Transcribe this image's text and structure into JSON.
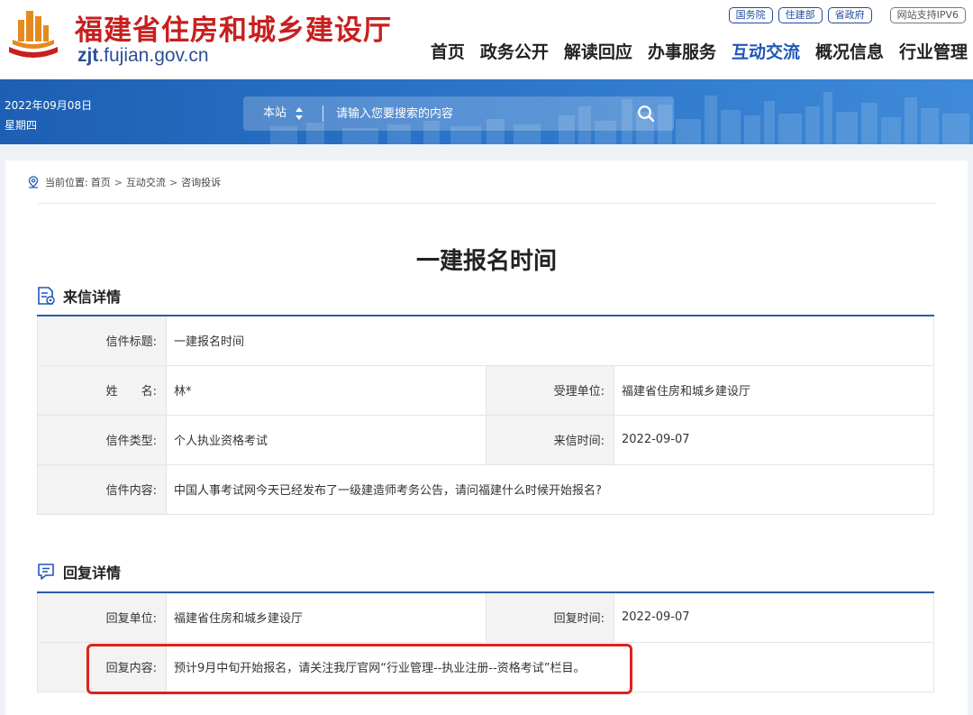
{
  "header": {
    "site_name": "福建省住房和城乡建设厅",
    "domain_bold": "zjt",
    "domain_rest": ".fujian.gov.cn",
    "top_links": [
      "国务院",
      "住建部",
      "省政府"
    ],
    "ipv6": "网站支持IPV6",
    "nav": [
      "首页",
      "政务公开",
      "解读回应",
      "办事服务",
      "互动交流",
      "概况信息",
      "行业管理"
    ],
    "active_nav": "互动交流",
    "colors": {
      "site_name": "#c81f1f",
      "active": "#1f56b8",
      "banner": "#2a73c8"
    }
  },
  "banner": {
    "date": "2022年09月08日",
    "weekday": "星期四",
    "search": {
      "scope": "本站",
      "placeholder": "请输入您要搜索的内容",
      "button_icon": "search-icon"
    }
  },
  "breadcrumb": {
    "prefix": "当前位置:",
    "items": [
      "首页",
      "互动交流",
      "咨询投诉"
    ],
    "separator": ">"
  },
  "page_title": "一建报名时间",
  "letter_section": {
    "title": "来信详情",
    "icon": "document-icon",
    "rows": {
      "title_label": "信件标题:",
      "title_value": "一建报名时间",
      "name_label": "姓　　名:",
      "name_value": "林*",
      "dept_label": "受理单位:",
      "dept_value": "福建省住房和城乡建设厅",
      "type_label": "信件类型:",
      "type_value": "个人执业资格考试",
      "time_label": "来信时间:",
      "time_value": "2022-09-07",
      "content_label": "信件内容:",
      "content_value": "中国人事考试网今天已经发布了一级建造师考务公告，请问福建什么时候开始报名?"
    }
  },
  "reply_section": {
    "title": "回复详情",
    "icon": "chat-icon",
    "rows": {
      "unit_label": "回复单位:",
      "unit_value": "福建省住房和城乡建设厅",
      "time_label": "回复时间:",
      "time_value": "2022-09-07",
      "content_label": "回复内容:",
      "content_value": "预计9月中旬开始报名，请关注我厅官网“行业管理--执业注册--资格考试”栏目。"
    }
  }
}
